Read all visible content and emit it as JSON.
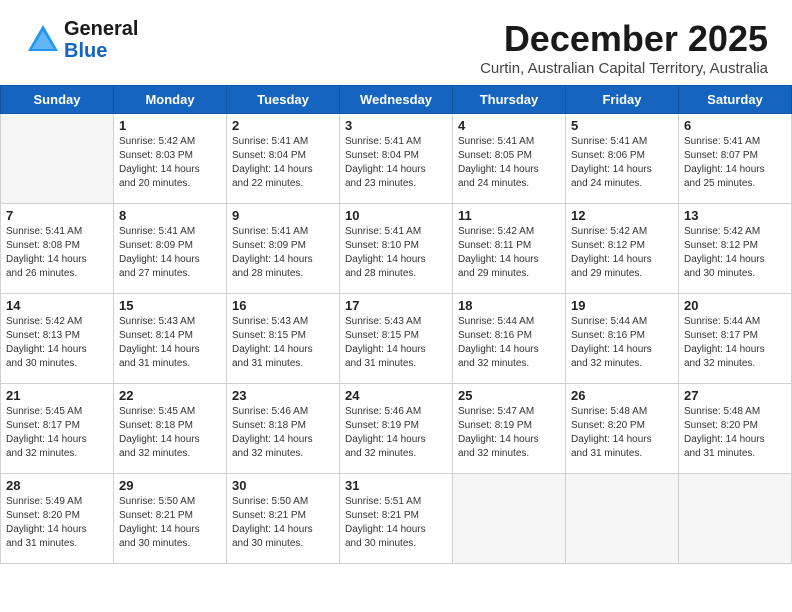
{
  "header": {
    "logo_general": "General",
    "logo_blue": "Blue",
    "month_title": "December 2025",
    "subtitle": "Curtin, Australian Capital Territory, Australia"
  },
  "weekdays": [
    "Sunday",
    "Monday",
    "Tuesday",
    "Wednesday",
    "Thursday",
    "Friday",
    "Saturday"
  ],
  "weeks": [
    [
      {
        "day": "",
        "info": ""
      },
      {
        "day": "1",
        "info": "Sunrise: 5:42 AM\nSunset: 8:03 PM\nDaylight: 14 hours\nand 20 minutes."
      },
      {
        "day": "2",
        "info": "Sunrise: 5:41 AM\nSunset: 8:04 PM\nDaylight: 14 hours\nand 22 minutes."
      },
      {
        "day": "3",
        "info": "Sunrise: 5:41 AM\nSunset: 8:04 PM\nDaylight: 14 hours\nand 23 minutes."
      },
      {
        "day": "4",
        "info": "Sunrise: 5:41 AM\nSunset: 8:05 PM\nDaylight: 14 hours\nand 24 minutes."
      },
      {
        "day": "5",
        "info": "Sunrise: 5:41 AM\nSunset: 8:06 PM\nDaylight: 14 hours\nand 24 minutes."
      },
      {
        "day": "6",
        "info": "Sunrise: 5:41 AM\nSunset: 8:07 PM\nDaylight: 14 hours\nand 25 minutes."
      }
    ],
    [
      {
        "day": "7",
        "info": "Sunrise: 5:41 AM\nSunset: 8:08 PM\nDaylight: 14 hours\nand 26 minutes."
      },
      {
        "day": "8",
        "info": "Sunrise: 5:41 AM\nSunset: 8:09 PM\nDaylight: 14 hours\nand 27 minutes."
      },
      {
        "day": "9",
        "info": "Sunrise: 5:41 AM\nSunset: 8:09 PM\nDaylight: 14 hours\nand 28 minutes."
      },
      {
        "day": "10",
        "info": "Sunrise: 5:41 AM\nSunset: 8:10 PM\nDaylight: 14 hours\nand 28 minutes."
      },
      {
        "day": "11",
        "info": "Sunrise: 5:42 AM\nSunset: 8:11 PM\nDaylight: 14 hours\nand 29 minutes."
      },
      {
        "day": "12",
        "info": "Sunrise: 5:42 AM\nSunset: 8:12 PM\nDaylight: 14 hours\nand 29 minutes."
      },
      {
        "day": "13",
        "info": "Sunrise: 5:42 AM\nSunset: 8:12 PM\nDaylight: 14 hours\nand 30 minutes."
      }
    ],
    [
      {
        "day": "14",
        "info": "Sunrise: 5:42 AM\nSunset: 8:13 PM\nDaylight: 14 hours\nand 30 minutes."
      },
      {
        "day": "15",
        "info": "Sunrise: 5:43 AM\nSunset: 8:14 PM\nDaylight: 14 hours\nand 31 minutes."
      },
      {
        "day": "16",
        "info": "Sunrise: 5:43 AM\nSunset: 8:15 PM\nDaylight: 14 hours\nand 31 minutes."
      },
      {
        "day": "17",
        "info": "Sunrise: 5:43 AM\nSunset: 8:15 PM\nDaylight: 14 hours\nand 31 minutes."
      },
      {
        "day": "18",
        "info": "Sunrise: 5:44 AM\nSunset: 8:16 PM\nDaylight: 14 hours\nand 32 minutes."
      },
      {
        "day": "19",
        "info": "Sunrise: 5:44 AM\nSunset: 8:16 PM\nDaylight: 14 hours\nand 32 minutes."
      },
      {
        "day": "20",
        "info": "Sunrise: 5:44 AM\nSunset: 8:17 PM\nDaylight: 14 hours\nand 32 minutes."
      }
    ],
    [
      {
        "day": "21",
        "info": "Sunrise: 5:45 AM\nSunset: 8:17 PM\nDaylight: 14 hours\nand 32 minutes."
      },
      {
        "day": "22",
        "info": "Sunrise: 5:45 AM\nSunset: 8:18 PM\nDaylight: 14 hours\nand 32 minutes."
      },
      {
        "day": "23",
        "info": "Sunrise: 5:46 AM\nSunset: 8:18 PM\nDaylight: 14 hours\nand 32 minutes."
      },
      {
        "day": "24",
        "info": "Sunrise: 5:46 AM\nSunset: 8:19 PM\nDaylight: 14 hours\nand 32 minutes."
      },
      {
        "day": "25",
        "info": "Sunrise: 5:47 AM\nSunset: 8:19 PM\nDaylight: 14 hours\nand 32 minutes."
      },
      {
        "day": "26",
        "info": "Sunrise: 5:48 AM\nSunset: 8:20 PM\nDaylight: 14 hours\nand 31 minutes."
      },
      {
        "day": "27",
        "info": "Sunrise: 5:48 AM\nSunset: 8:20 PM\nDaylight: 14 hours\nand 31 minutes."
      }
    ],
    [
      {
        "day": "28",
        "info": "Sunrise: 5:49 AM\nSunset: 8:20 PM\nDaylight: 14 hours\nand 31 minutes."
      },
      {
        "day": "29",
        "info": "Sunrise: 5:50 AM\nSunset: 8:21 PM\nDaylight: 14 hours\nand 30 minutes."
      },
      {
        "day": "30",
        "info": "Sunrise: 5:50 AM\nSunset: 8:21 PM\nDaylight: 14 hours\nand 30 minutes."
      },
      {
        "day": "31",
        "info": "Sunrise: 5:51 AM\nSunset: 8:21 PM\nDaylight: 14 hours\nand 30 minutes."
      },
      {
        "day": "",
        "info": ""
      },
      {
        "day": "",
        "info": ""
      },
      {
        "day": "",
        "info": ""
      }
    ]
  ]
}
